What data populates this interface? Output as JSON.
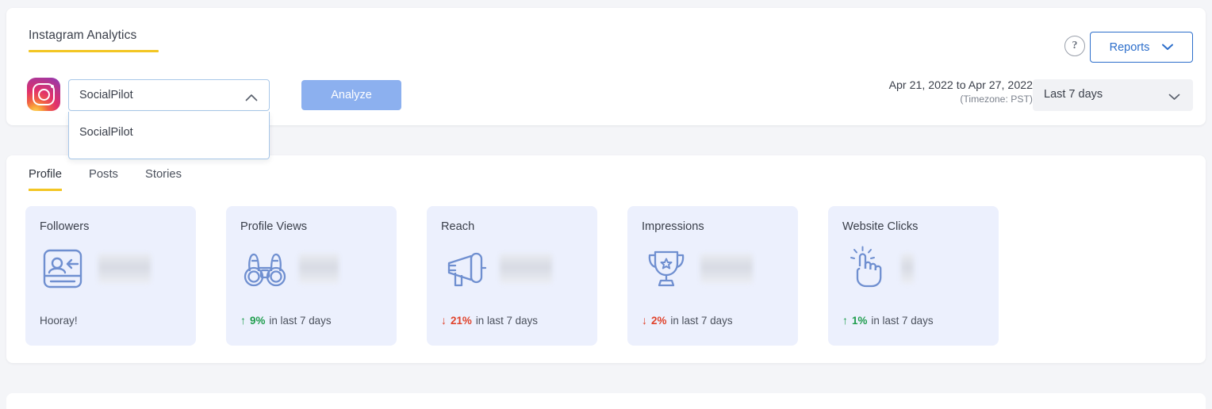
{
  "header": {
    "page_title": "Instagram Analytics",
    "help_icon": "question-mark-icon",
    "reports_label": "Reports",
    "reports_chevron": "chevron-down-icon",
    "network_icon": "instagram-logo-icon",
    "account_select": {
      "value": "SocialPilot",
      "chevron": "chevron-up-icon",
      "open": true,
      "options": [
        "SocialPilot"
      ]
    },
    "analyze_label": "Analyze",
    "date_range_text": "Apr 21, 2022 to Apr 27, 2022",
    "timezone_text": "(Timezone: PST)",
    "range_select": {
      "value": "Last 7 days",
      "chevron": "chevron-down-icon"
    }
  },
  "main": {
    "tabs": [
      {
        "label": "Profile",
        "active": true
      },
      {
        "label": "Posts",
        "active": false
      },
      {
        "label": "Stories",
        "active": false
      }
    ],
    "cards": [
      {
        "title": "Followers",
        "icon": "followers-card-icon",
        "value_hidden": true,
        "value_width": "lg",
        "footer_text": "Hooray!",
        "trend": null
      },
      {
        "title": "Profile Views",
        "icon": "binoculars-icon",
        "value_hidden": true,
        "value_width": "md",
        "trend": {
          "direction": "up",
          "arrow": "↑",
          "percent": "9%",
          "suffix": "in last 7 days"
        }
      },
      {
        "title": "Reach",
        "icon": "megaphone-icon",
        "value_hidden": true,
        "value_width": "lg",
        "trend": {
          "direction": "down",
          "arrow": "↓",
          "percent": "21%",
          "suffix": "in last 7 days"
        }
      },
      {
        "title": "Impressions",
        "icon": "trophy-icon",
        "value_hidden": true,
        "value_width": "lg",
        "trend": {
          "direction": "down",
          "arrow": "↓",
          "percent": "2%",
          "suffix": "in last 7 days"
        }
      },
      {
        "title": "Website Clicks",
        "icon": "click-hand-icon",
        "value_hidden": true,
        "value_width": "sm",
        "trend": {
          "direction": "up",
          "arrow": "↑",
          "percent": "1%",
          "suffix": "in last 7 days"
        }
      }
    ]
  },
  "colors": {
    "accent_yellow": "#f3c623",
    "link_blue": "#2c6ecb",
    "analyze_blue": "#8cb0ef",
    "card_bg": "#ecf0fd",
    "icon_blue": "#6f8fd0",
    "up_green": "#1f9d4d",
    "down_red": "#e0422b"
  }
}
